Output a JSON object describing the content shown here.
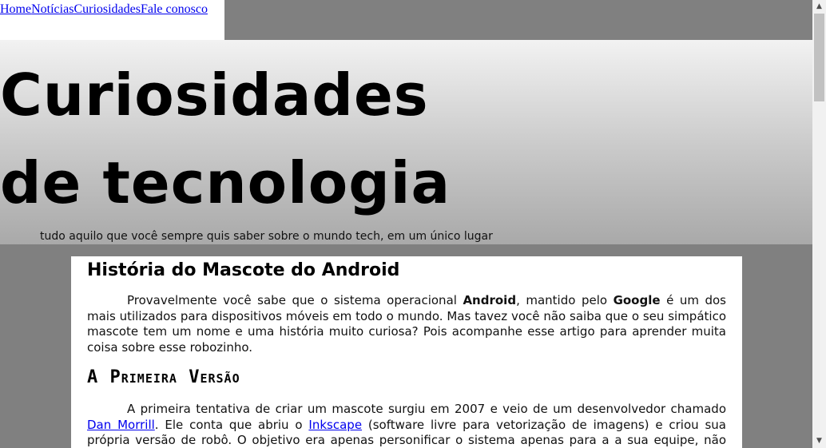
{
  "nav": {
    "items": [
      {
        "label": "Home"
      },
      {
        "label": "Notícias"
      },
      {
        "label": "Curiosidades"
      },
      {
        "label": "Fale conosco"
      }
    ]
  },
  "header": {
    "title": "Curiosidades de tecnologia",
    "tagline": "tudo aquilo que você sempre quis saber sobre o mundo tech, em um único lugar"
  },
  "article": {
    "title": "História do Mascote do Android",
    "intro": {
      "t1": "Provavelmente você sabe que o sistema operacional ",
      "b1": "Android",
      "t2": ", mantido pelo ",
      "b2": "Google",
      "t3": " é um dos mais utilizados para dispositivos móveis em todo o mundo. Mas tavez você não saiba que o seu simpático mascote tem um nome e uma história muito curiosa? Pois acompanhe esse artigo para aprender muita coisa sobre esse robozinho."
    },
    "section_title": "A Primeira Versão",
    "section_p": {
      "t1": "A primeira tentativa de criar um mascote surgiu em 2007 e veio de um desenvolvedor chamado ",
      "link1": "Dan Morrill",
      "t2": ". Ele conta que abriu o ",
      "link2": "Inkscape",
      "t3": " (software livre para vetorização de imagens) e criou sua própria versão de robô. O objetivo era apenas personificar o sistema apenas para a a sua equipe, não existia nenhuma solicitação"
    }
  },
  "scrollbar": {
    "up_icon": "arrow-up-icon",
    "down_icon": "arrow-down-icon"
  }
}
